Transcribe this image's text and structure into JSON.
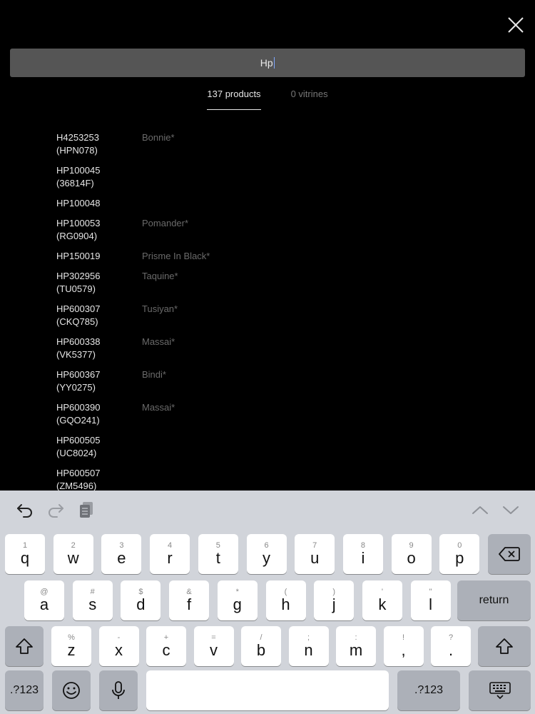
{
  "search": {
    "query": "Hp"
  },
  "tabs": [
    {
      "label": "137 products",
      "active": true
    },
    {
      "label": "0 vitrines",
      "active": false
    }
  ],
  "results": [
    {
      "code": "H4253253",
      "alt": "(HPN078)",
      "name": "Bonnie*"
    },
    {
      "code": "HP100045",
      "alt": "(36814F)",
      "name": ""
    },
    {
      "code": "HP100048",
      "alt": "",
      "name": ""
    },
    {
      "code": "HP100053",
      "alt": "(RG0904)",
      "name": "Pomander*"
    },
    {
      "code": "HP150019",
      "alt": "",
      "name": "Prisme In Black*"
    },
    {
      "code": "HP302956",
      "alt": "(TU0579)",
      "name": "Taquine*"
    },
    {
      "code": "HP600307",
      "alt": "(CKQ785)",
      "name": "Tusiyan*"
    },
    {
      "code": "HP600338",
      "alt": "(VK5377)",
      "name": "Massai*"
    },
    {
      "code": "HP600367",
      "alt": "(YY0275)",
      "name": "Bindi*"
    },
    {
      "code": "HP600390",
      "alt": "(GQO241)",
      "name": "Massai*"
    },
    {
      "code": "HP600505",
      "alt": "(UC8024)",
      "name": ""
    },
    {
      "code": "HP600507",
      "alt": "(ZM5496)",
      "name": ""
    }
  ],
  "keyboard": {
    "row1": [
      {
        "hint": "1",
        "key": "q"
      },
      {
        "hint": "2",
        "key": "w"
      },
      {
        "hint": "3",
        "key": "e"
      },
      {
        "hint": "4",
        "key": "r"
      },
      {
        "hint": "5",
        "key": "t"
      },
      {
        "hint": "6",
        "key": "y"
      },
      {
        "hint": "7",
        "key": "u"
      },
      {
        "hint": "8",
        "key": "i"
      },
      {
        "hint": "9",
        "key": "o"
      },
      {
        "hint": "0",
        "key": "p"
      }
    ],
    "row2": [
      {
        "hint": "@",
        "key": "a"
      },
      {
        "hint": "#",
        "key": "s"
      },
      {
        "hint": "$",
        "key": "d"
      },
      {
        "hint": "&",
        "key": "f"
      },
      {
        "hint": "*",
        "key": "g"
      },
      {
        "hint": "(",
        "key": "h"
      },
      {
        "hint": ")",
        "key": "j"
      },
      {
        "hint": "'",
        "key": "k"
      },
      {
        "hint": "\"",
        "key": "l"
      }
    ],
    "row3": [
      {
        "hint": "%",
        "key": "z"
      },
      {
        "hint": "-",
        "key": "x"
      },
      {
        "hint": "+",
        "key": "c"
      },
      {
        "hint": "=",
        "key": "v"
      },
      {
        "hint": "/",
        "key": "b"
      },
      {
        "hint": ";",
        "key": "n"
      },
      {
        "hint": ":",
        "key": "m"
      },
      {
        "hint": "!",
        "key": ","
      },
      {
        "hint": "?",
        "key": "."
      }
    ],
    "return_label": "return",
    "numbers_label": ".?123",
    "numbers_label_right": ".?123"
  }
}
